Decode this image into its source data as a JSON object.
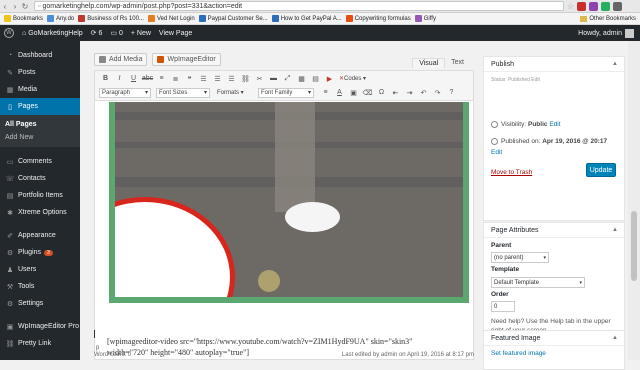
{
  "browser": {
    "url": "gomarketinghelp.com/wp-admin/post.php?post=331&action=edit",
    "bookmarks": [
      {
        "label": "Bookmarks",
        "color": "#f0c419"
      },
      {
        "label": "Any.do",
        "color": "#4a90d9"
      },
      {
        "label": "Business of Rs 100...",
        "color": "#c0392b"
      },
      {
        "label": "Ved Net Login",
        "color": "#e67e22"
      },
      {
        "label": "Paypal Customer Se...",
        "color": "#2c6ebd"
      },
      {
        "label": "How to Get PayPal A...",
        "color": "#2c6ebd"
      },
      {
        "label": "Copywriting formulas",
        "color": "#e84e0f"
      },
      {
        "label": "Giffy",
        "color": "#9b59b6"
      }
    ],
    "other_bookmarks": "Other Bookmarks"
  },
  "adminbar": {
    "site": "GoMarketingHelp",
    "updates": "6",
    "comments": "0",
    "new": "New",
    "view": "View Page",
    "howdy": "Howdy, admin"
  },
  "sidebar": {
    "items": [
      {
        "label": "Dashboard",
        "icon": "dashboard-icon"
      },
      {
        "label": "Posts",
        "icon": "pin-icon"
      },
      {
        "label": "Media",
        "icon": "media-icon"
      },
      {
        "label": "Pages",
        "icon": "pages-icon"
      }
    ],
    "sub": [
      "All Pages",
      "Add New"
    ],
    "items2": [
      {
        "label": "Comments",
        "icon": "comments-icon"
      },
      {
        "label": "Contacts",
        "icon": "contacts-icon"
      },
      {
        "label": "Portfolio Items",
        "icon": "portfolio-icon"
      },
      {
        "label": "Xtreme Options",
        "icon": "options-icon"
      }
    ],
    "items3": [
      {
        "label": "Appearance",
        "icon": "appearance-icon"
      },
      {
        "label": "Plugins",
        "icon": "plugins-icon",
        "badge": "3"
      },
      {
        "label": "Users",
        "icon": "users-icon"
      },
      {
        "label": "Tools",
        "icon": "tools-icon"
      },
      {
        "label": "Settings",
        "icon": "settings-icon"
      }
    ],
    "items4": [
      {
        "label": "WpImageEditor Pro",
        "icon": "imageeditor-icon"
      },
      {
        "label": "Pretty Link",
        "icon": "link-icon"
      }
    ]
  },
  "editor": {
    "add_media": "Add Media",
    "wpimageeditor": "WpImageEditor",
    "tab_visual": "Visual",
    "tab_text": "Text",
    "format_select": "Paragraph",
    "font_sizes": "Font Sizes",
    "formats": "Formats",
    "font_family": "Font Family",
    "codes": "Codes",
    "shortcode": "[wpimageeditor-video src=\"https://www.youtube.com/watch?v=ZIM1HydF9UA\" skin=\"skin3\" width=\"720\" height=\"480\" autoplay=\"true\"]",
    "path": "p",
    "word_count": "Word count: 0",
    "last_edited": "Last edited by admin on April 19, 2016 at 8:17 pm"
  },
  "publish": {
    "title": "Publish",
    "status_partial": "Status: Published Edit",
    "visibility_label": "Visibility:",
    "visibility_value": "Public",
    "edit": "Edit",
    "published_label": "Published on:",
    "published_value": "Apr 19, 2016 @ 20:17",
    "edit2": "Edit",
    "trash": "Move to Trash",
    "update": "Update"
  },
  "page_attributes": {
    "title": "Page Attributes",
    "parent_label": "Parent",
    "parent_value": "(no parent)",
    "template_label": "Template",
    "template_value": "Default Template",
    "order_label": "Order",
    "order_value": "0",
    "help": "Need help? Use the Help tab in the upper right of your screen."
  },
  "featured": {
    "title": "Featured Image",
    "link": "Set featured image"
  }
}
